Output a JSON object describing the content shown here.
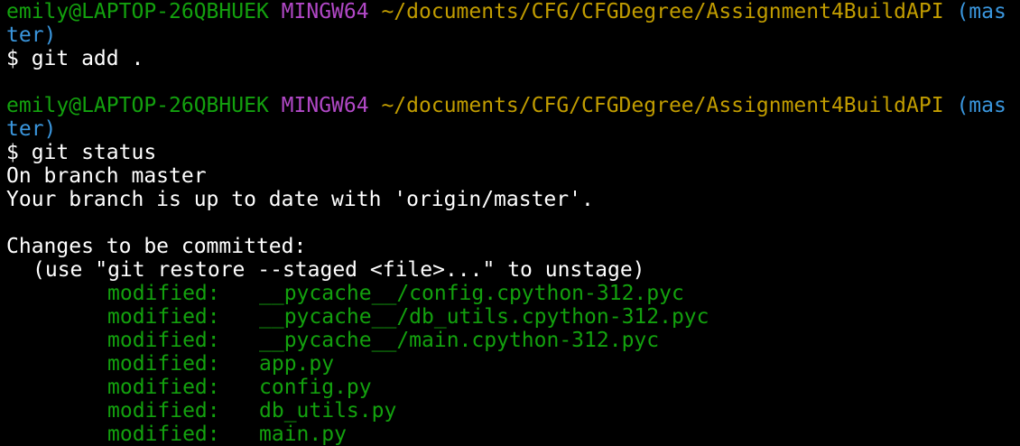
{
  "colors": {
    "background": "#000000",
    "user_host": "#13a10e",
    "msystem": "#b148c6",
    "path": "#c19c00",
    "branch": "#3a96dd",
    "text": "#ffffff",
    "modified": "#13a10e"
  },
  "prompts": [
    {
      "user_host": "emily@LAPTOP-26QBHUEK",
      "msystem": "MINGW64",
      "path": "~/documents/CFG/CFGDegree/Assignment4BuildAPI",
      "branch_part1": "(mas",
      "branch_part2": "ter)",
      "command": "$ git add ."
    },
    {
      "user_host": "emily@LAPTOP-26QBHUEK",
      "msystem": "MINGW64",
      "path": "~/documents/CFG/CFGDegree/Assignment4BuildAPI",
      "branch_part1": "(mas",
      "branch_part2": "ter)",
      "command": "$ git status"
    }
  ],
  "output": {
    "branch_line": "On branch master",
    "up_to_date_line": "Your branch is up to date with 'origin/master'.",
    "changes_header": "Changes to be committed:",
    "hint_line": "(use \"git restore --staged <file>...\" to unstage)",
    "modified_label": "modified:",
    "modified_files": [
      "__pycache__/config.cpython-312.pyc",
      "__pycache__/db_utils.cpython-312.pyc",
      "__pycache__/main.cpython-312.pyc",
      "app.py",
      "config.py",
      "db_utils.py",
      "main.py"
    ]
  }
}
